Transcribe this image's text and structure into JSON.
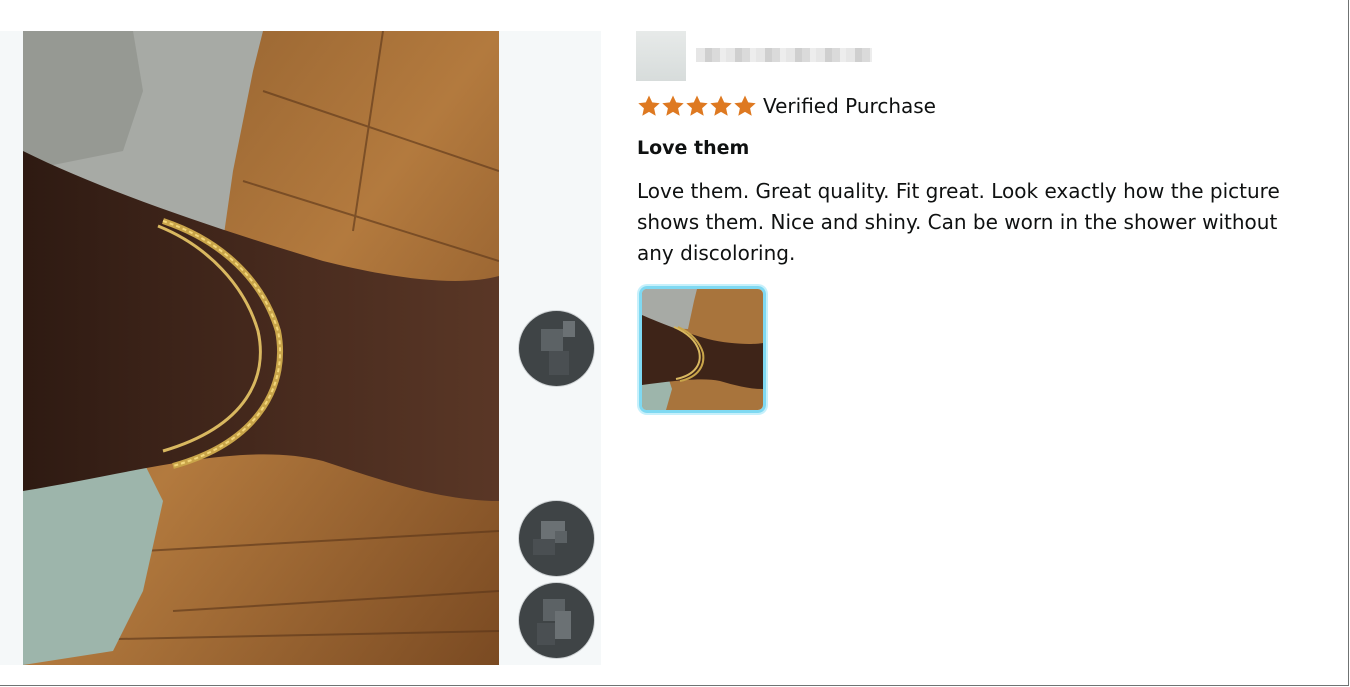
{
  "review": {
    "rating": 5,
    "rating_max": 5,
    "verified_label": "Verified Purchase",
    "title": "Love them",
    "body": "Love them. Great quality. Fit great. Look exactly how the picture shows them. Nice and shiny. Can be worn in the shower without any discoloring."
  },
  "colors": {
    "star": "#de7921",
    "panel_bg": "#f5f8f9",
    "thumb_border": "#7fd9f2",
    "nav_button": "#3f4446"
  },
  "icons": {
    "star": "star-icon",
    "avatar": "avatar-placeholder",
    "nav_thumbnails": [
      "reviewer-thumbnail-1",
      "reviewer-thumbnail-2",
      "reviewer-thumbnail-3"
    ]
  }
}
